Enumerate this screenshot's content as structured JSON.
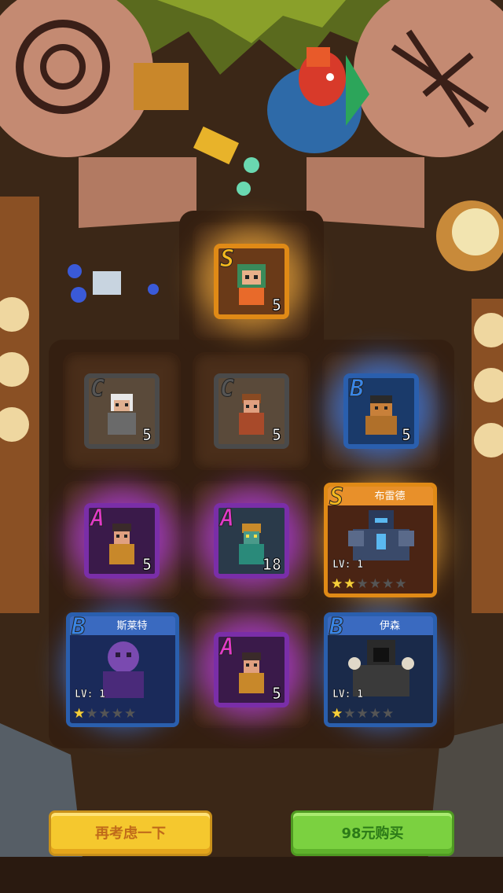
{
  "cards": [
    {
      "id": "top",
      "rank": "S",
      "count": "5",
      "frame": "gold"
    },
    {
      "id": "r1c1",
      "rank": "C",
      "count": "5",
      "frame": "gray"
    },
    {
      "id": "r1c2",
      "rank": "C",
      "count": "5",
      "frame": "gray"
    },
    {
      "id": "r1c3",
      "rank": "B",
      "count": "5",
      "frame": "blue"
    },
    {
      "id": "r2c1",
      "rank": "A",
      "count": "5",
      "frame": "purple"
    },
    {
      "id": "r2c2",
      "rank": "A",
      "count": "18",
      "frame": "purple"
    },
    {
      "id": "r3c2",
      "rank": "A",
      "count": "5",
      "frame": "purple"
    }
  ],
  "heroes": [
    {
      "id": "brad",
      "rank": "S",
      "name": "布雷德",
      "level": "LV: 1",
      "stars_on": 2,
      "stars_total": 6
    },
    {
      "id": "slate",
      "rank": "B",
      "name": "斯莱特",
      "level": "LV: 1",
      "stars_on": 1,
      "stars_total": 5
    },
    {
      "id": "ethan",
      "rank": "B",
      "name": "伊森",
      "level": "LV: 1",
      "stars_on": 1,
      "stars_total": 5
    }
  ],
  "buttons": {
    "reconsider": "再考虑一下",
    "buy": "98元购买"
  },
  "colors": {
    "gold": "#e08a16",
    "gray": "#4a4a4a",
    "blue": "#2a5fae",
    "purple": "#7a2ea8",
    "rank_S": "#f6b91d",
    "rank_A": "#e03ac8",
    "rank_B": "#3a86e6",
    "rank_C": "#555555"
  }
}
